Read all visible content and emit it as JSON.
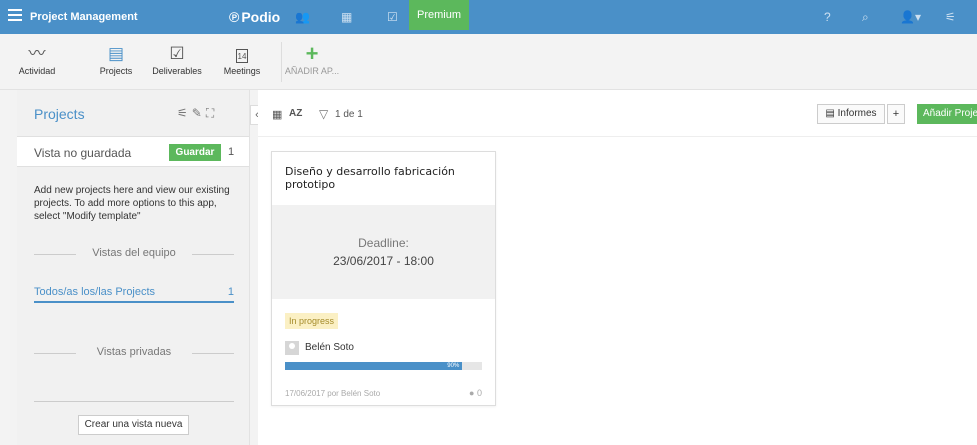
{
  "topbar": {
    "workspace_title": "Project Management",
    "logo_text": "Podio",
    "premium_label": "Premium",
    "help_label": "?"
  },
  "appbar": {
    "items": [
      {
        "label": "Actividad",
        "icon": "activity-icon"
      },
      {
        "label": "Projects",
        "icon": "document-icon"
      },
      {
        "label": "Deliverables",
        "icon": "checkbox-icon"
      },
      {
        "label": "Meetings",
        "icon": "calendar-icon",
        "calendar_day": "14"
      }
    ],
    "add_label": "AÑADIR AP..."
  },
  "sidebar": {
    "title": "Projects",
    "unsaved_label": "Vista no guardada",
    "save_label": "Guardar",
    "unsaved_count": "1",
    "description": "Add new projects here and view our existing projects. To add more options to this app, select \"Modify template\"",
    "team_views_label": "Vistas del equipo",
    "view_item_label": "Todos/as los/las Projects",
    "view_item_count": "1",
    "private_views_label": "Vistas privadas",
    "new_view_label": "Crear una vista nueva"
  },
  "toolbar": {
    "sort_label": "AZ",
    "count_label": "1 de 1",
    "reports_label": "Informes",
    "plus_label": "+",
    "add_project_label": "Añadir Proje"
  },
  "card": {
    "title": "Diseño y desarrollo fabricación prototipo",
    "deadline_label": "Deadline:",
    "deadline_value": "23/06/2017 - 18:00",
    "status": "In progress",
    "person": "Belén Soto",
    "progress": 90,
    "progress_label": "90%",
    "footer": "17/06/2017 por Belén Soto",
    "comments": "0"
  },
  "colors": {
    "topbar": "#4a90c8",
    "accent_green": "#5cb85c",
    "link_blue": "#4a90c8"
  }
}
